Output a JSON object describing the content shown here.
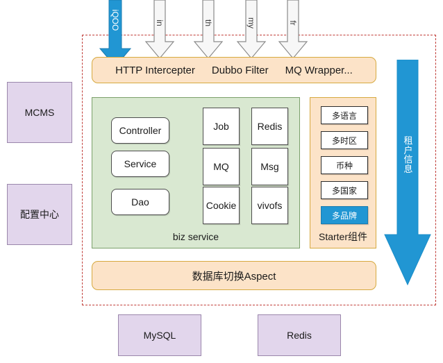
{
  "diagram": {
    "title": "tenant-aware service architecture",
    "colors": {
      "external_fill": "#e2d6ec",
      "external_stroke": "#9a86ab",
      "boundary_dashed": "#c03b36",
      "orange_fill": "#fce3c8",
      "orange_stroke": "#d6a93f",
      "biz_fill": "#d9e8d1",
      "biz_stroke": "#7ba06a",
      "accent_blue": "#2196d3",
      "chip_fill": "#ffffff",
      "chip_stroke": "#4d4d4d"
    }
  },
  "inbound_arrows": [
    {
      "name": "tenant-entry-arrow",
      "label": "iQOO",
      "color": "#2196d3",
      "style": "filled-blue"
    },
    {
      "name": "channel-arrow-in",
      "label": "in",
      "color": "#ffffff",
      "style": "outline-gray"
    },
    {
      "name": "channel-arrow-th",
      "label": "th",
      "color": "#ffffff",
      "style": "outline-gray"
    },
    {
      "name": "channel-arrow-my",
      "label": "my",
      "color": "#ffffff",
      "style": "outline-gray"
    },
    {
      "name": "channel-arrow-fr",
      "label": "fr",
      "color": "#ffffff",
      "style": "outline-gray"
    }
  ],
  "entry_layer": {
    "name": "entry-interceptors-bar",
    "items": [
      "HTTP Intercepter",
      "Dubbo Filter",
      "MQ Wrapper..."
    ]
  },
  "biz_service": {
    "label": "biz service",
    "layers": [
      "Controller",
      "Service",
      "Dao"
    ],
    "components_left": [
      "Job",
      "MQ",
      "Cookie"
    ],
    "components_right": [
      "Redis",
      "Msg",
      "vivofs"
    ]
  },
  "starter": {
    "label": "Starter组件",
    "items": [
      {
        "label": "多语言",
        "active": false
      },
      {
        "label": "多时区",
        "active": false
      },
      {
        "label": "币种",
        "active": false
      },
      {
        "label": "多国家",
        "active": false
      },
      {
        "label": "多品牌",
        "active": true
      }
    ]
  },
  "aspect_bar": {
    "label": "数据库切换Aspect"
  },
  "tenant_arrow": {
    "label": "租户信息",
    "chars": [
      "租",
      "户",
      "信",
      "息"
    ],
    "color": "#2196d3"
  },
  "left_systems": [
    {
      "label": "MCMS"
    },
    {
      "label": "配置中心"
    }
  ],
  "datastores": [
    {
      "label": "MySQL"
    },
    {
      "label": "Redis"
    }
  ]
}
